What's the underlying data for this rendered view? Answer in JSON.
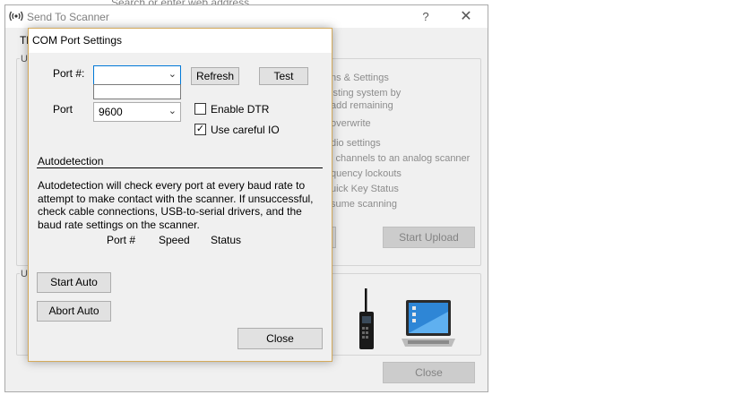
{
  "background": {
    "address_placeholder": "Search or enter web address"
  },
  "main_window": {
    "title": "Send To Scanner",
    "help": "?",
    "close_icon": "✕",
    "tab_partial": "Th",
    "upload_group_letter": "U",
    "image_group_letter": "U",
    "options": [
      "ns & Settings",
      "isting system by",
      "add remaining",
      "overwrite",
      "dio settings",
      "l channels to an analog scanner",
      "quency lockouts",
      "uick Key Status",
      "sume scanning"
    ],
    "start_upload": "Start Upload",
    "close": "Close",
    "icons": [
      "radio-wave-icon",
      "scanner-icon",
      "laptop-icon"
    ]
  },
  "dialog": {
    "title": "COM Port Settings",
    "port_label": "Port #:",
    "port_value": "",
    "baud_label": "Port",
    "baud_value": "9600",
    "refresh": "Refresh",
    "test": "Test",
    "enable_dtr": {
      "label": "Enable DTR",
      "checked": false
    },
    "use_careful_io": {
      "label": "Use careful IO",
      "checked": true
    },
    "autodetection_header": "Autodetection",
    "autodetection_text": "Autodetection will check every port at every baud rate to attempt to make contact with the scanner. If unsuccessful, check cable connections, USB-to-serial drivers, and the baud rate settings on the scanner.",
    "columns": [
      "Port #",
      "Speed",
      "Status"
    ],
    "start_auto": "Start Auto",
    "abort_auto": "Abort Auto",
    "close": "Close",
    "check_mark": "✓",
    "chevron": "⌄"
  },
  "colors": {
    "dialog_border": "#d4aa5c",
    "focus_border": "#0078d7",
    "window_bg": "#f0f0f0",
    "disabled_text": "#8c8c8c"
  }
}
